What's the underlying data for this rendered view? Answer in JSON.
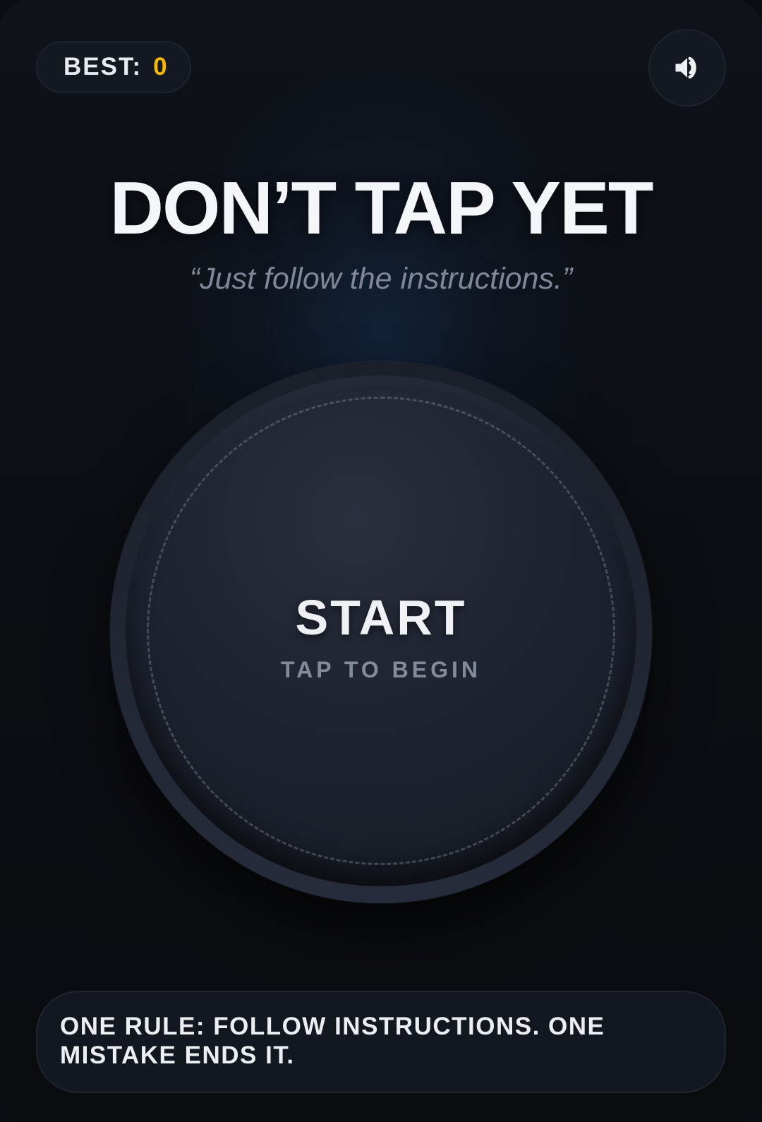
{
  "best": {
    "label": "BEST:",
    "value": "0"
  },
  "sound": {
    "icon": "speaker-volume-icon"
  },
  "title": "DON’T TAP YET",
  "subtitle": "“Just follow the instructions.”",
  "start_button": {
    "label": "START",
    "sublabel": "TAP TO BEGIN"
  },
  "rule_banner": {
    "text": "ONE RULE: FOLLOW INSTRUCTIONS. ONE MISTAKE ENDS IT."
  },
  "colors": {
    "accent_gold": "#f5b800",
    "background": "#0b0d12",
    "text_primary": "#f3f5f9",
    "text_muted": "#7f8798"
  }
}
